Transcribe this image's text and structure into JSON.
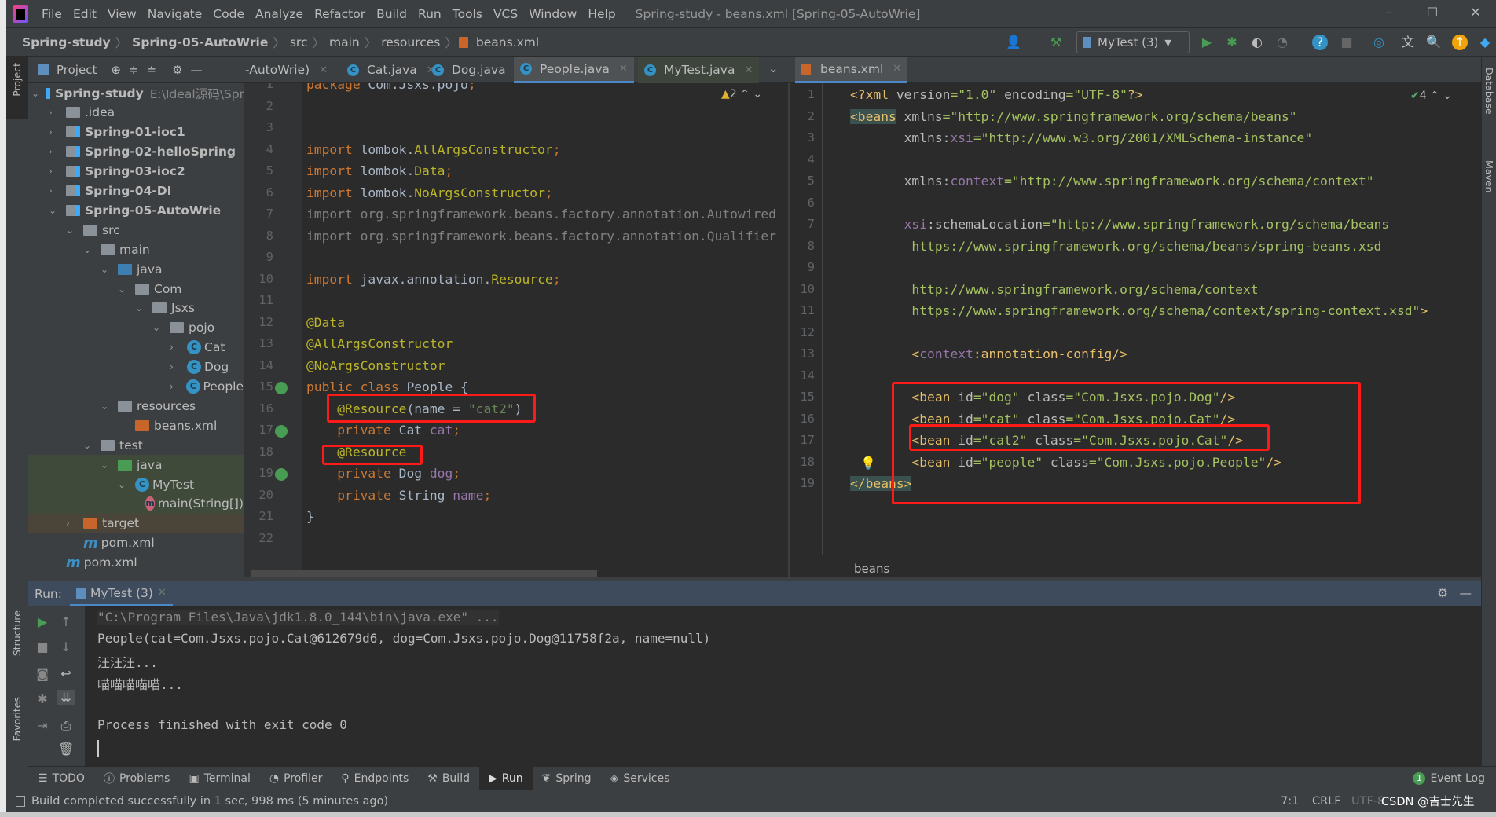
{
  "title_bar": {
    "menus": [
      "File",
      "Edit",
      "View",
      "Navigate",
      "Code",
      "Analyze",
      "Refactor",
      "Build",
      "Run",
      "Tools",
      "VCS",
      "Window",
      "Help"
    ],
    "window_title": "Spring-study - beans.xml [Spring-05-AutoWrie]",
    "minimize": "–",
    "maximize": "☐",
    "close": "✕"
  },
  "breadcrumb": [
    "Spring-study",
    "Spring-05-AutoWrie",
    "src",
    "main",
    "resources",
    "beans.xml"
  ],
  "toolbar": {
    "run_config": "MyTest (3)"
  },
  "left_strip": {
    "project": "Project",
    "structure": "Structure",
    "favorites": "Favorites"
  },
  "right_strip": {
    "database": "Database",
    "maven": "Maven"
  },
  "project_panel": {
    "title": "Project",
    "tree": [
      {
        "label": "Spring-study",
        "extra": "E:\\Ideal源码\\Spr",
        "depth": 0,
        "arrow": "open",
        "icon": "module",
        "bold": true
      },
      {
        "label": ".idea",
        "depth": 1,
        "arrow": "closed",
        "icon": "folder"
      },
      {
        "label": "Spring-01-ioc1",
        "depth": 1,
        "arrow": "closed",
        "icon": "module",
        "bold": true
      },
      {
        "label": "Spring-02-helloSpring",
        "depth": 1,
        "arrow": "closed",
        "icon": "module",
        "bold": true
      },
      {
        "label": "Spring-03-ioc2",
        "depth": 1,
        "arrow": "closed",
        "icon": "module",
        "bold": true
      },
      {
        "label": "Spring-04-DI",
        "depth": 1,
        "arrow": "closed",
        "icon": "module",
        "bold": true
      },
      {
        "label": "Spring-05-AutoWrie",
        "depth": 1,
        "arrow": "open",
        "icon": "module",
        "bold": true
      },
      {
        "label": "src",
        "depth": 2,
        "arrow": "open",
        "icon": "folder"
      },
      {
        "label": "main",
        "depth": 3,
        "arrow": "open",
        "icon": "folder"
      },
      {
        "label": "java",
        "depth": 4,
        "arrow": "open",
        "icon": "src-folder"
      },
      {
        "label": "Com",
        "depth": 5,
        "arrow": "open",
        "icon": "package"
      },
      {
        "label": "Jsxs",
        "depth": 6,
        "arrow": "open",
        "icon": "package"
      },
      {
        "label": "pojo",
        "depth": 7,
        "arrow": "open",
        "icon": "package"
      },
      {
        "label": "Cat",
        "depth": 8,
        "arrow": "closed",
        "icon": "class"
      },
      {
        "label": "Dog",
        "depth": 8,
        "arrow": "closed",
        "icon": "class"
      },
      {
        "label": "People",
        "depth": 8,
        "arrow": "closed",
        "icon": "class"
      },
      {
        "label": "resources",
        "depth": 4,
        "arrow": "open",
        "icon": "res-folder"
      },
      {
        "label": "beans.xml",
        "depth": 5,
        "arrow": "none",
        "icon": "xml"
      },
      {
        "label": "test",
        "depth": 3,
        "arrow": "open",
        "icon": "folder"
      },
      {
        "label": "java",
        "depth": 4,
        "arrow": "open",
        "icon": "test-folder",
        "highlight": "test"
      },
      {
        "label": "MyTest",
        "depth": 5,
        "arrow": "open",
        "icon": "class",
        "highlight": "test"
      },
      {
        "label": "main(String[])",
        "depth": 6,
        "arrow": "none",
        "icon": "method",
        "highlight": "test"
      },
      {
        "label": "target",
        "depth": 2,
        "arrow": "closed",
        "icon": "target-folder",
        "highlight": "excluded"
      },
      {
        "label": "pom.xml",
        "depth": 2,
        "arrow": "none",
        "icon": "maven"
      },
      {
        "label": "pom.xml",
        "depth": 1,
        "arrow": "none",
        "icon": "maven"
      }
    ]
  },
  "editor_tabs": [
    {
      "label": "-AutoWrie)",
      "icon": "none"
    },
    {
      "label": "Cat.java",
      "icon": "class"
    },
    {
      "label": "Dog.java",
      "icon": "class"
    },
    {
      "label": "People.java",
      "icon": "class",
      "active": true
    },
    {
      "label": "MyTest.java",
      "icon": "test-class"
    },
    {
      "label": "beans.xml",
      "icon": "xml",
      "active": true
    }
  ],
  "java_editor": {
    "warnings": "2",
    "lines": [
      [
        [
          "package ",
          "kw"
        ],
        [
          "Com.Jsxs.pojo",
          "df"
        ],
        [
          ";",
          "kw"
        ]
      ],
      [],
      [],
      [
        [
          "import ",
          "kw"
        ],
        [
          "lombok.",
          "df"
        ],
        [
          "AllArgsConstructor",
          "an"
        ],
        [
          ";",
          "kw"
        ]
      ],
      [
        [
          "import ",
          "kw"
        ],
        [
          "lombok.",
          "df"
        ],
        [
          "Data",
          "an"
        ],
        [
          ";",
          "kw"
        ]
      ],
      [
        [
          "import ",
          "kw"
        ],
        [
          "lombok.",
          "df"
        ],
        [
          "NoArgsConstructor",
          "an"
        ],
        [
          ";",
          "kw"
        ]
      ],
      [
        [
          "import org.springframework.beans.factory.annotation.Autowired",
          "gr"
        ]
      ],
      [
        [
          "import org.springframework.beans.factory.annotation.Qualifier",
          "gr"
        ]
      ],
      [],
      [
        [
          "import ",
          "kw"
        ],
        [
          "javax.annotation.",
          "df"
        ],
        [
          "Resource",
          "an"
        ],
        [
          ";",
          "kw"
        ]
      ],
      [],
      [
        [
          "@Data",
          "an"
        ]
      ],
      [
        [
          "@AllArgsConstructor",
          "an"
        ]
      ],
      [
        [
          "@NoArgsConstructor",
          "an"
        ]
      ],
      [
        [
          "public class ",
          "kw"
        ],
        [
          "People ",
          "df"
        ],
        [
          "{",
          "df"
        ]
      ],
      [
        [
          "    ",
          "df"
        ],
        [
          "@Resource",
          "an"
        ],
        [
          "(name = ",
          "df"
        ],
        [
          "\"cat2\"",
          "st"
        ],
        [
          ")",
          "df"
        ]
      ],
      [
        [
          "    private ",
          "kw"
        ],
        [
          "Cat ",
          "df"
        ],
        [
          "cat",
          "fd"
        ],
        [
          ";",
          "kw"
        ]
      ],
      [
        [
          "    ",
          "df"
        ],
        [
          "@Resource",
          "an"
        ]
      ],
      [
        [
          "    private ",
          "kw"
        ],
        [
          "Dog ",
          "df"
        ],
        [
          "dog",
          "fd"
        ],
        [
          ";",
          "kw"
        ]
      ],
      [
        [
          "    private ",
          "kw"
        ],
        [
          "String ",
          "df"
        ],
        [
          "name",
          "fd"
        ],
        [
          ";",
          "kw"
        ]
      ],
      [
        [
          "}",
          "df"
        ]
      ],
      []
    ]
  },
  "xml_editor": {
    "checks": "4",
    "breadcrumb": "beans",
    "lines": [
      [
        [
          "<?xml ",
          "tg"
        ],
        [
          "version",
          "at"
        ],
        [
          "=\"1.0\" ",
          "vl"
        ],
        [
          "encoding",
          "at"
        ],
        [
          "=\"UTF-8\"",
          "vl"
        ],
        [
          "?>",
          "tg"
        ]
      ],
      [
        [
          "<beans",
          "tg tghl"
        ],
        [
          " xmlns",
          "at"
        ],
        [
          "=\"http://www.springframework.org/schema/beans\"",
          "vl"
        ]
      ],
      [
        [
          "       xmlns:",
          "at"
        ],
        [
          "xsi",
          "ns"
        ],
        [
          "=\"http://www.w3.org/2001/XMLSchema-instance\"",
          "vl"
        ]
      ],
      [],
      [
        [
          "       xmlns:",
          "at"
        ],
        [
          "context",
          "ns"
        ],
        [
          "=\"http://www.springframework.org/schema/context\"",
          "vl"
        ]
      ],
      [],
      [
        [
          "       ",
          "at"
        ],
        [
          "xsi",
          "ns"
        ],
        [
          ":schemaLocation",
          "at"
        ],
        [
          "=\"http://www.springframework.org/schema/beans",
          "vl"
        ]
      ],
      [
        [
          "        https://www.springframework.org/schema/beans/spring-beans.xsd",
          "vl"
        ]
      ],
      [],
      [
        [
          "        http://www.springframework.org/schema/context",
          "vl"
        ]
      ],
      [
        [
          "        https://www.springframework.org/schema/context/spring-context.xsd\"",
          "vl"
        ],
        [
          ">",
          "tg"
        ]
      ],
      [],
      [
        [
          "        <",
          "tg"
        ],
        [
          "context",
          "ns"
        ],
        [
          ":annotation-config/>",
          "tg"
        ]
      ],
      [],
      [
        [
          "        <bean ",
          "tg"
        ],
        [
          "id",
          "at"
        ],
        [
          "=\"dog\" ",
          "vl"
        ],
        [
          "class",
          "at"
        ],
        [
          "=\"Com.Jsxs.pojo.Dog\"",
          "vl"
        ],
        [
          "/>",
          "tg"
        ]
      ],
      [
        [
          "        <bean ",
          "tg"
        ],
        [
          "id",
          "at"
        ],
        [
          "=\"cat\" ",
          "vl"
        ],
        [
          "class",
          "at"
        ],
        [
          "=\"Com.Jsxs.pojo.Cat\"",
          "vl"
        ],
        [
          "/>",
          "tg"
        ]
      ],
      [
        [
          "        <bean ",
          "tg"
        ],
        [
          "id",
          "at"
        ],
        [
          "=\"cat2\" ",
          "vl"
        ],
        [
          "class",
          "at"
        ],
        [
          "=\"Com.Jsxs.pojo.Cat\"",
          "vl"
        ],
        [
          "/>",
          "tg"
        ]
      ],
      [
        [
          "        <bean ",
          "tg"
        ],
        [
          "id",
          "at"
        ],
        [
          "=\"people\" ",
          "vl"
        ],
        [
          "class",
          "at"
        ],
        [
          "=\"Com.Jsxs.pojo.People\"",
          "vl"
        ],
        [
          "/>",
          "tg"
        ]
      ],
      [
        [
          "</beans>",
          "tg tghl"
        ]
      ]
    ]
  },
  "run_panel": {
    "label": "Run:",
    "tab": "MyTest (3)",
    "console": [
      "\"C:\\Program Files\\Java\\jdk1.8.0_144\\bin\\java.exe\" ...",
      "People(cat=Com.Jsxs.pojo.Cat@612679d6, dog=Com.Jsxs.pojo.Dog@11758f2a, name=null)",
      "汪汪汪...",
      "喵喵喵喵喵...",
      "",
      "Process finished with exit code 0"
    ]
  },
  "bottom_tools": [
    "TODO",
    "Problems",
    "Terminal",
    "Profiler",
    "Endpoints",
    "Build",
    "Run",
    "Spring",
    "Services"
  ],
  "bottom_tools_active": "Run",
  "event_log": {
    "label": "Event Log",
    "count": "1"
  },
  "status_bar": {
    "message": "Build completed successfully in 1 sec, 998 ms (5 minutes ago)",
    "position": "7:1",
    "line_sep": "CRLF",
    "encoding": "UTF-8",
    "watermark": "CSDN @吉士先生"
  },
  "colors": {
    "accent": "#4a88c7",
    "highlight_box": "#ff1a1a",
    "editor_bg": "#2b2b2b",
    "panel_bg": "#3c3f41"
  }
}
